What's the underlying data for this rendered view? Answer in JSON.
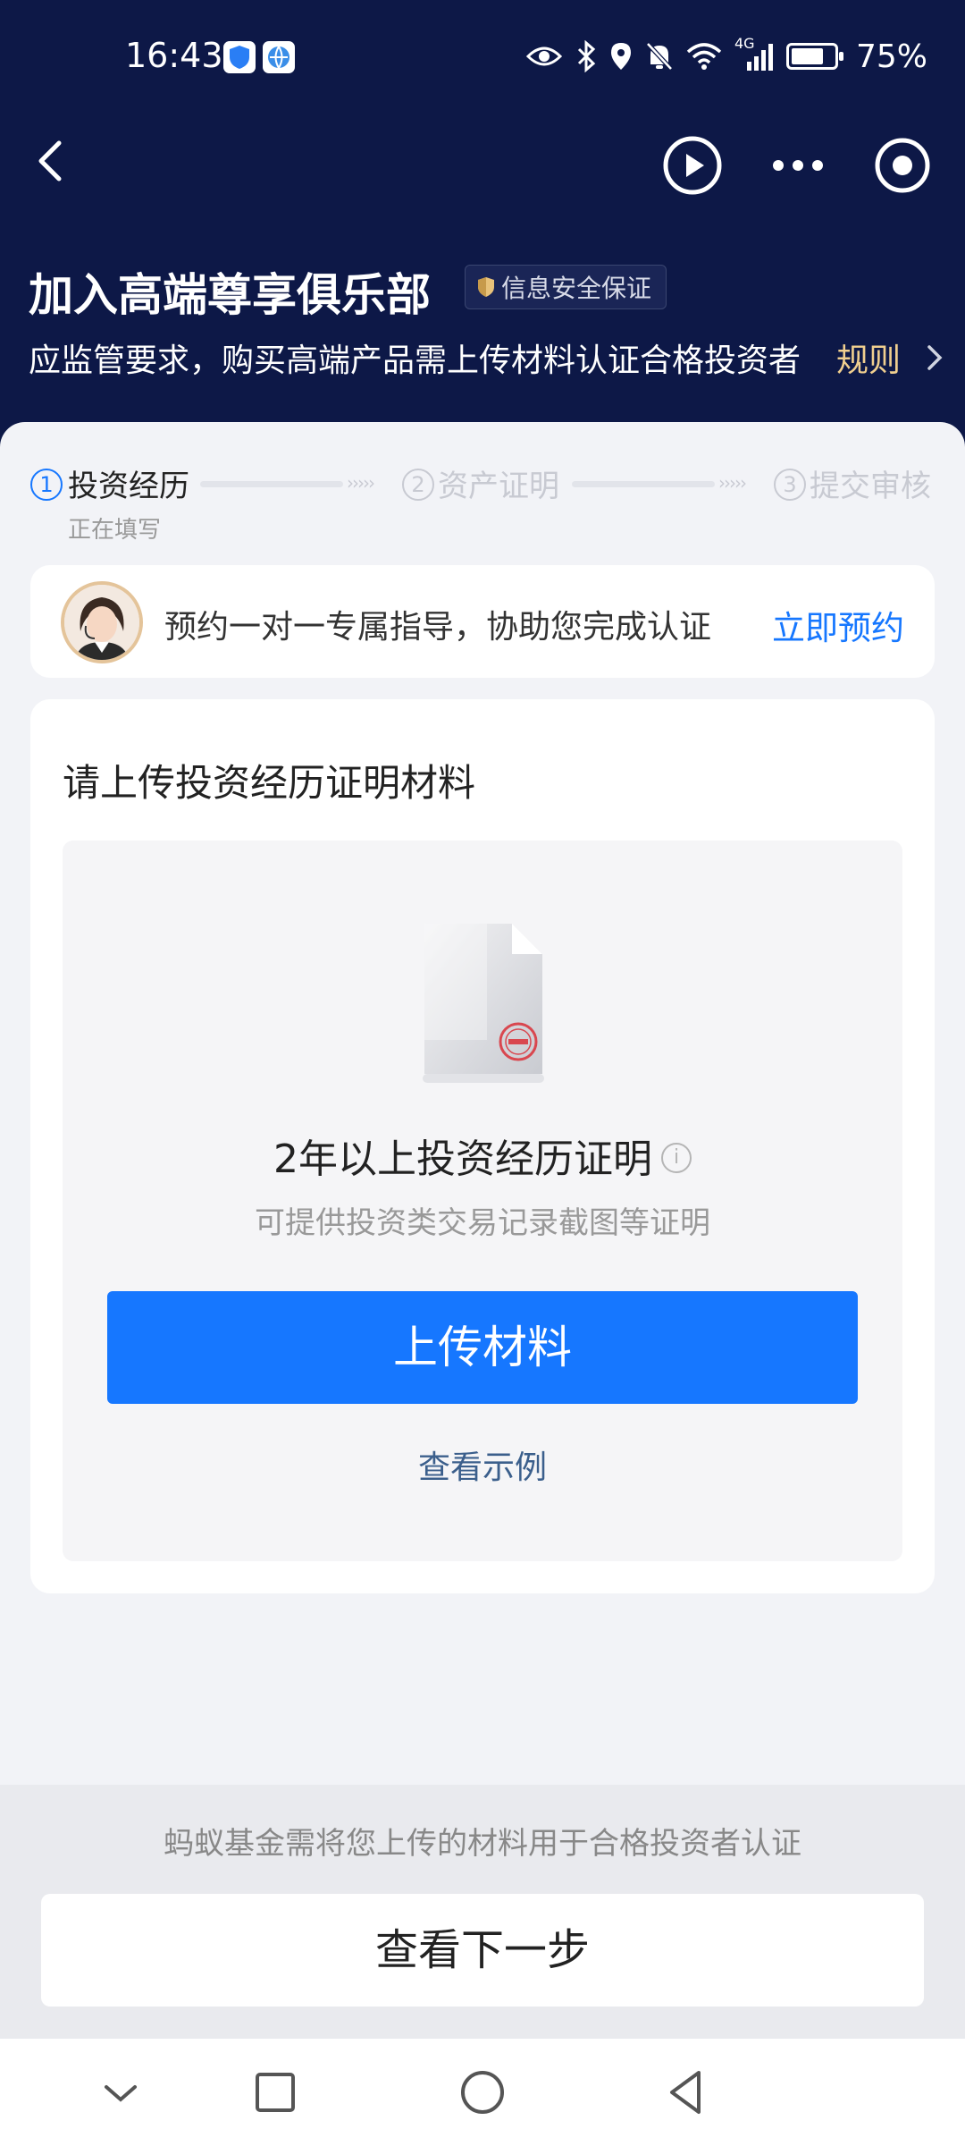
{
  "status_bar": {
    "time": "16:43",
    "network": "4G",
    "battery_percent": "75%",
    "battery_level": 0.75
  },
  "header": {
    "title": "加入高端尊享俱乐部",
    "badge": "信息安全保证",
    "subtitle": "应监管要求，购买高端产品需上传材料认证合格投资者",
    "rule_link": "规则"
  },
  "steps": [
    {
      "number": "1",
      "label": "投资经历",
      "state": "active"
    },
    {
      "number": "2",
      "label": "资产证明",
      "state": "inactive"
    },
    {
      "number": "3",
      "label": "提交审核",
      "state": "inactive"
    }
  ],
  "step_hint": "正在填写",
  "advisor": {
    "text": "预约一对一专属指导，协助您完成认证",
    "link": "立即预约"
  },
  "upload": {
    "title": "请上传投资经历证明材料",
    "heading": "2年以上投资经历证明",
    "info_icon": "i",
    "description": "可提供投资类交易记录截图等证明",
    "button": "上传材料",
    "example_link": "查看示例"
  },
  "footer": {
    "note": "蚂蚁基金需将您上传的材料用于合格投资者认证",
    "next_button": "查看下一步"
  },
  "colors": {
    "header_bg": "#0d1847",
    "accent": "#1677ff",
    "rule_gold": "#f0cf8f"
  }
}
